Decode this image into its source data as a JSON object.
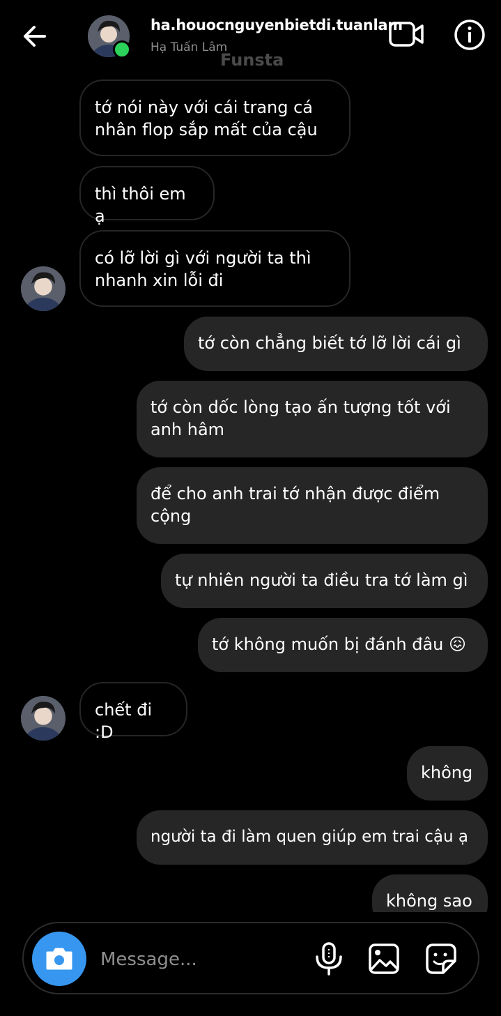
{
  "header": {
    "username": "ha.houocnguyenbietdi.tuanlam",
    "display_name": "Hạ Tuấn Lâm",
    "watermark": "Funsta"
  },
  "messages": [
    {
      "side": "in",
      "text": "tớ nói này với cái trang cá nhân flop sắp mất của cậu",
      "avatar": false
    },
    {
      "side": "in",
      "text": "thì thôi em ạ",
      "avatar": false
    },
    {
      "side": "in",
      "text": "có lỡ lời gì với người ta thì nhanh xin lỗi đi",
      "avatar": true
    },
    {
      "side": "out",
      "text": "tớ còn chẳng biết tớ lỡ lời cái gì"
    },
    {
      "side": "out",
      "text": "tớ còn dốc lòng tạo ấn tượng tốt với anh hâm"
    },
    {
      "side": "out",
      "text": "để cho anh trai tớ nhận được điểm cộng"
    },
    {
      "side": "out",
      "text": "tự nhiên người ta điều tra tớ làm gì"
    },
    {
      "side": "out",
      "text": "tớ không muốn bị đánh đâu 😖"
    },
    {
      "side": "in",
      "text": "chết đi :D",
      "avatar": true
    },
    {
      "side": "out",
      "text": "không"
    },
    {
      "side": "out",
      "text": "người ta đi làm quen giúp em trai cậu ạ"
    },
    {
      "side": "out",
      "text": "không sao"
    }
  ],
  "composer": {
    "placeholder": "Message..."
  },
  "icons": {
    "back": "arrow-left-icon",
    "video": "video-camera-icon",
    "info": "info-icon",
    "camera": "camera-icon",
    "mic": "microphone-icon",
    "gallery": "image-icon",
    "sticker": "sticker-icon"
  },
  "colors": {
    "accent": "#3797f0",
    "online": "#2bd35a",
    "outgoing_bubble": "#262626",
    "background": "#000000"
  }
}
